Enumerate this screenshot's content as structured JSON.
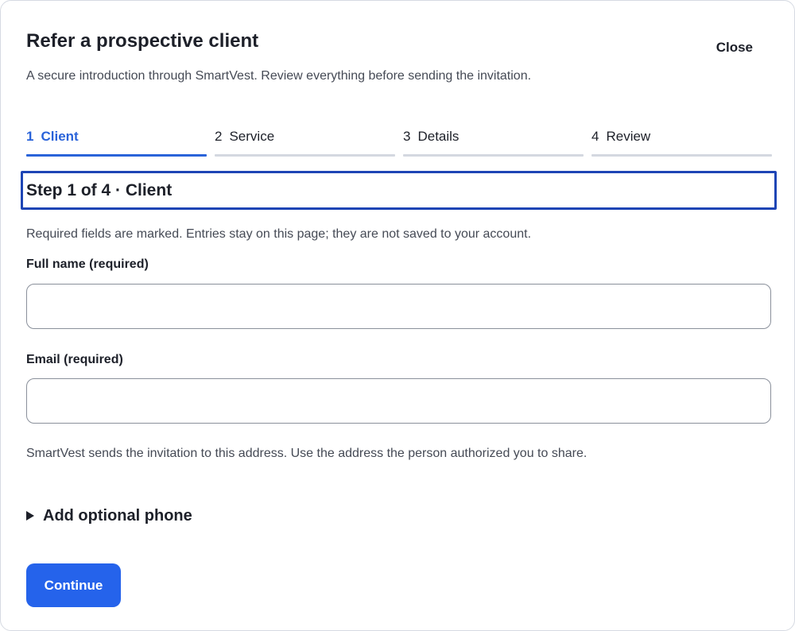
{
  "dialog": {
    "title": "Refer a prospective client",
    "close_label": "Close",
    "subtitle": "A secure introduction through SmartVest. Review everything before sending the invitation."
  },
  "steps": [
    {
      "number": "1",
      "label": "Client",
      "active": true
    },
    {
      "number": "2",
      "label": "Service",
      "active": false
    },
    {
      "number": "3",
      "label": "Details",
      "active": false
    },
    {
      "number": "4",
      "label": "Review",
      "active": false
    }
  ],
  "section": {
    "title": "Step 1 of 4 · Client",
    "note": "Required fields are marked. Entries stay on this page; they are not saved to your account."
  },
  "fields": {
    "full_name": {
      "label": "Full name (required)",
      "value": ""
    },
    "email": {
      "label": "Email (required)",
      "value": "",
      "hint": "SmartVest sends the invitation to this address. Use the address the person authorized you to share."
    }
  },
  "optional_phone": {
    "label": "Add optional phone",
    "icon": "disclosure-triangle-icon"
  },
  "actions": {
    "continue_label": "Continue"
  },
  "colors": {
    "accent": "#2a63d9",
    "primary_button": "#2563eb",
    "focus_outline": "#1e45b5",
    "inactive_step_bar": "#d4d8e0"
  }
}
